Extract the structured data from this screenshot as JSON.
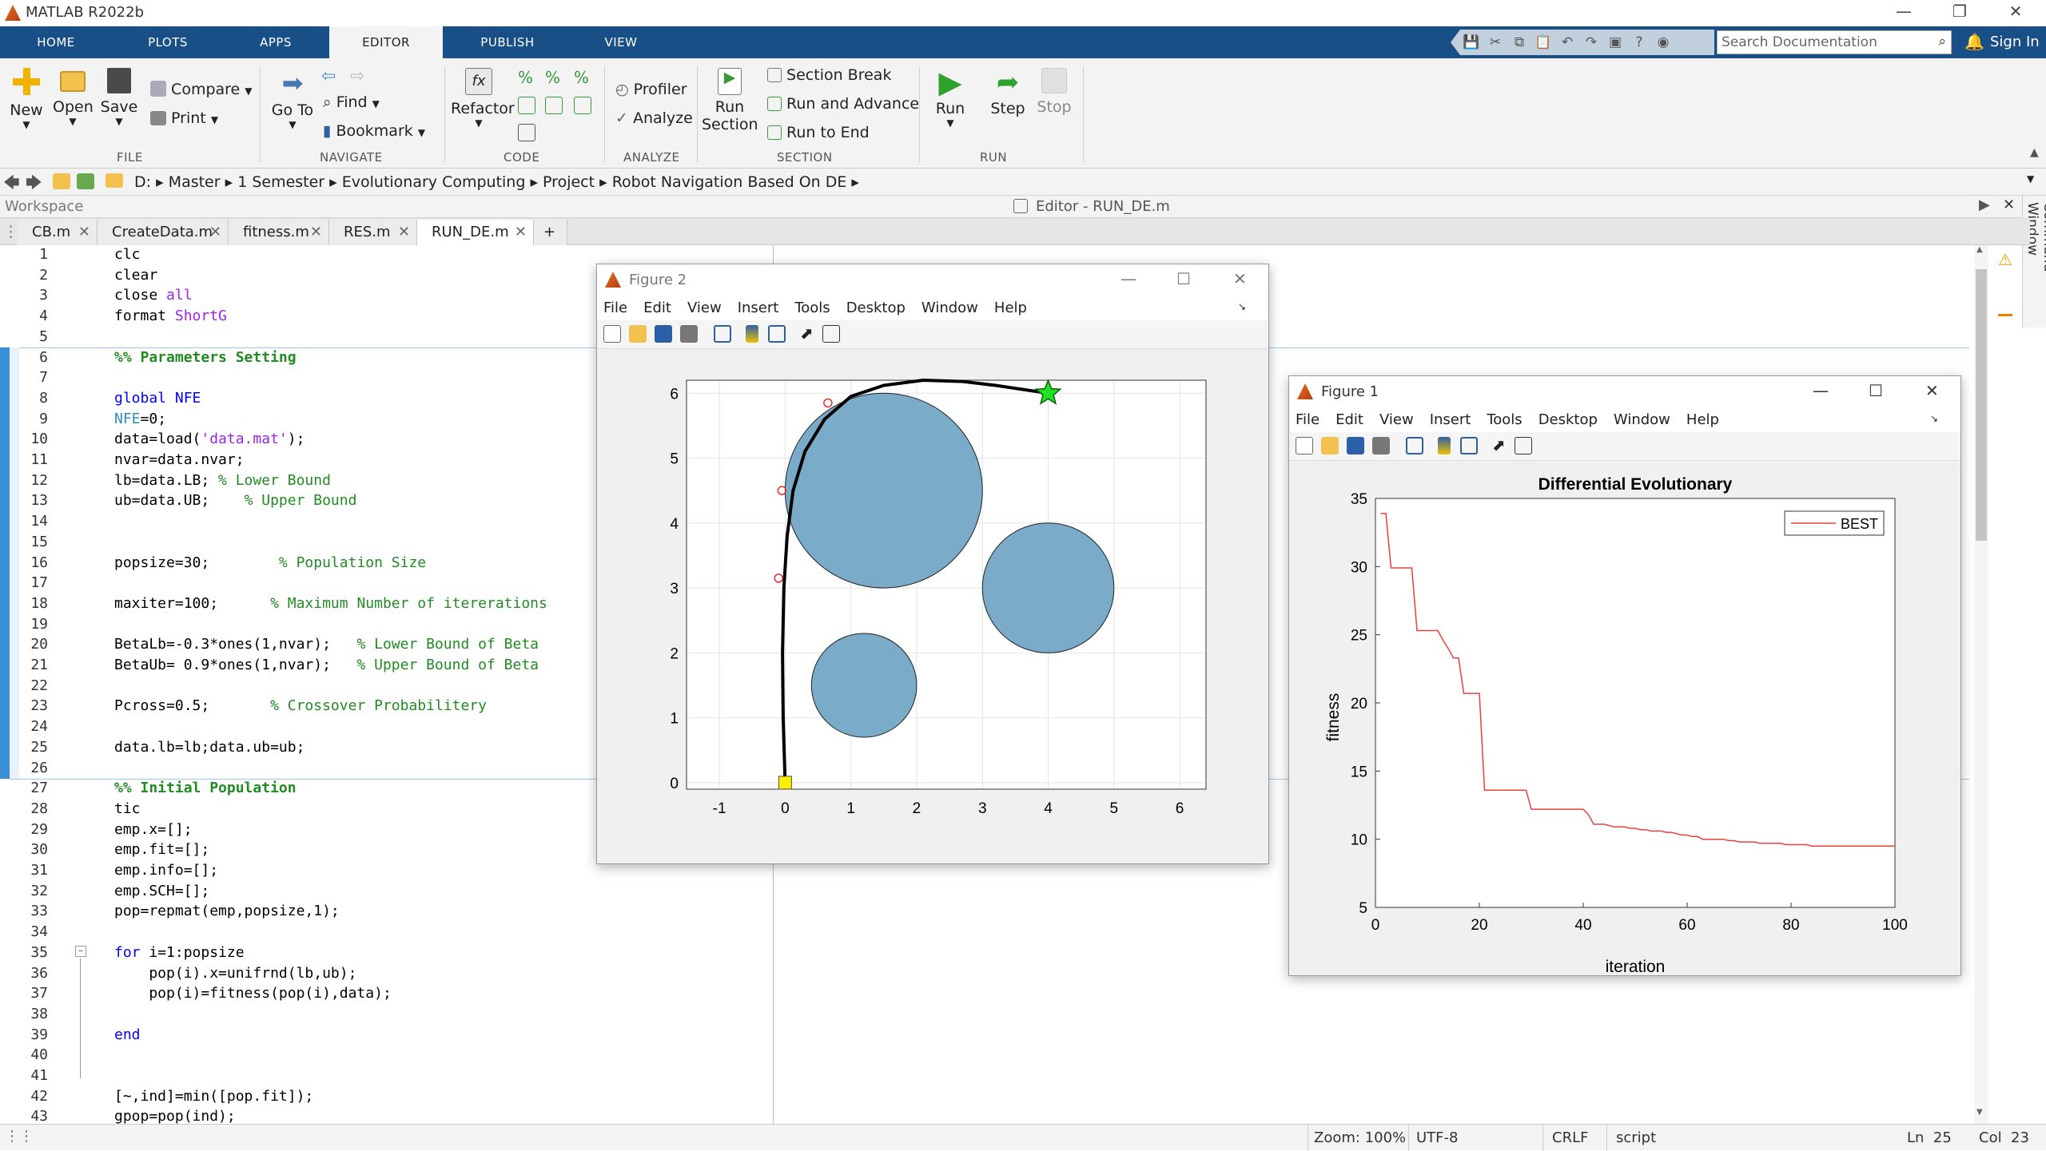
{
  "app": {
    "title": "MATLAB R2022b"
  },
  "toolstrip": {
    "tabs": [
      "HOME",
      "PLOTS",
      "APPS",
      "EDITOR",
      "PUBLISH",
      "VIEW"
    ],
    "search_placeholder": "Search Documentation",
    "signin": "Sign In"
  },
  "ribbon": {
    "file": {
      "new": "New",
      "open": "Open",
      "save": "Save",
      "compare": "Compare",
      "print": "Print",
      "group": "FILE"
    },
    "navigate": {
      "goto": "Go To",
      "find": "Find",
      "bookmark": "Bookmark",
      "group": "NAVIGATE"
    },
    "code": {
      "refactor": "Refactor",
      "group": "CODE"
    },
    "analyze": {
      "profiler": "Profiler",
      "analyze": "Analyze",
      "group": "ANALYZE"
    },
    "section": {
      "run_section": "Run Section",
      "section_break": "Section Break",
      "run_advance": "Run and Advance",
      "run_end": "Run to End",
      "group": "SECTION"
    },
    "run": {
      "run": "Run",
      "step": "Step",
      "stop": "Stop",
      "group": "RUN"
    }
  },
  "address": [
    "D:",
    "Master",
    "1 Semester",
    "Evolutionary Computing",
    "Project",
    "Robot Navigation Based On DE"
  ],
  "workspace_label": "Workspace",
  "editor_title": "Editor - RUN_DE.m",
  "command_window_label": "Command Window",
  "editor_tabs": [
    "CB.m",
    "CreateData.m",
    "fitness.m",
    "RES.m",
    "RUN_DE.m"
  ],
  "code_lines": [
    {
      "n": "1",
      "t": "clc"
    },
    {
      "n": "2",
      "t": "clear"
    },
    {
      "n": "3",
      "t": "close all"
    },
    {
      "n": "4",
      "t": "format ShortG"
    },
    {
      "n": "5",
      "t": ""
    },
    {
      "n": "6",
      "t": "%% Parameters Setting"
    },
    {
      "n": "7",
      "t": ""
    },
    {
      "n": "8",
      "t": "global NFE"
    },
    {
      "n": "9",
      "t": "NFE=0;"
    },
    {
      "n": "10",
      "t": "data=load('data.mat');"
    },
    {
      "n": "11",
      "t": "nvar=data.nvar;"
    },
    {
      "n": "12",
      "t": "lb=data.LB; % Lower Bound"
    },
    {
      "n": "13",
      "t": "ub=data.UB;    % Upper Bound"
    },
    {
      "n": "14",
      "t": ""
    },
    {
      "n": "15",
      "t": ""
    },
    {
      "n": "16",
      "t": "popsize=30;        % Population Size"
    },
    {
      "n": "17",
      "t": ""
    },
    {
      "n": "18",
      "t": "maxiter=100;      % Maximum Number of itererations"
    },
    {
      "n": "19",
      "t": ""
    },
    {
      "n": "20",
      "t": "BetaLb=-0.3*ones(1,nvar);   % Lower Bound of Beta"
    },
    {
      "n": "21",
      "t": "BetaUb= 0.9*ones(1,nvar);   % Upper Bound of Beta"
    },
    {
      "n": "22",
      "t": ""
    },
    {
      "n": "23",
      "t": "Pcross=0.5;       % Crossover Probabilitery"
    },
    {
      "n": "24",
      "t": ""
    },
    {
      "n": "25",
      "t": "data.lb=lb;data.ub=ub;"
    },
    {
      "n": "26",
      "t": ""
    },
    {
      "n": "27",
      "t": "%% Initial Population"
    },
    {
      "n": "28",
      "t": "tic"
    },
    {
      "n": "29",
      "t": "emp.x=[];"
    },
    {
      "n": "30",
      "t": "emp.fit=[];"
    },
    {
      "n": "31",
      "t": "emp.info=[];"
    },
    {
      "n": "32",
      "t": "emp.SCH=[];"
    },
    {
      "n": "33",
      "t": "pop=repmat(emp,popsize,1);"
    },
    {
      "n": "34",
      "t": ""
    },
    {
      "n": "35",
      "t": "for i=1:popsize"
    },
    {
      "n": "36",
      "t": "    pop(i).x=unifrnd(lb,ub);"
    },
    {
      "n": "37",
      "t": "    pop(i)=fitness(pop(i),data);"
    },
    {
      "n": "38",
      "t": ""
    },
    {
      "n": "39",
      "t": "end"
    },
    {
      "n": "40",
      "t": ""
    },
    {
      "n": "41",
      "t": ""
    },
    {
      "n": "42",
      "t": "[~,ind]=min([pop.fit]);"
    },
    {
      "n": "43",
      "t": "gpop=pop(ind);"
    }
  ],
  "status": {
    "zoom": "Zoom: 100%",
    "encoding": "UTF-8",
    "eol": "CRLF",
    "type": "script",
    "ln": "Ln  25",
    "col": "Col  23"
  },
  "figure_menu": [
    "File",
    "Edit",
    "View",
    "Insert",
    "Tools",
    "Desktop",
    "Window",
    "Help"
  ],
  "figure2": {
    "title": "Figure 2",
    "xticks": [
      "-1",
      "0",
      "1",
      "2",
      "3",
      "4",
      "5",
      "6"
    ],
    "yticks": [
      "0",
      "1",
      "2",
      "3",
      "4",
      "5",
      "6"
    ]
  },
  "figure1": {
    "title": "Figure 1",
    "plot_title": "Differential Evolutionary",
    "xlabel": "iteration",
    "ylabel": "fitness",
    "legend": "BEST",
    "xticks": [
      "0",
      "20",
      "40",
      "60",
      "80",
      "100"
    ],
    "yticks": [
      "5",
      "10",
      "15",
      "20",
      "25",
      "30",
      "35"
    ]
  },
  "chart_data": [
    {
      "type": "scatter",
      "title": "",
      "xlim": [
        -1.5,
        6.4
      ],
      "ylim": [
        -0.1,
        6.2
      ],
      "grid": true,
      "obstacles": [
        {
          "cx": 1.5,
          "cy": 4.5,
          "r": 1.5
        },
        {
          "cx": 4.0,
          "cy": 3.0,
          "r": 1.0
        },
        {
          "cx": 1.2,
          "cy": 1.5,
          "r": 0.8
        }
      ],
      "start": [
        0,
        0
      ],
      "goal": [
        4,
        6
      ],
      "path_x": [
        0,
        -0.03,
        -0.04,
        -0.02,
        0.03,
        0.12,
        0.3,
        0.6,
        1.0,
        1.5,
        2.1,
        2.7,
        3.2,
        3.6,
        4.0
      ],
      "path_y": [
        0,
        1.0,
        2.0,
        3.0,
        3.8,
        4.5,
        5.1,
        5.6,
        5.95,
        6.12,
        6.2,
        6.18,
        6.12,
        6.06,
        6.0
      ],
      "waypoints_x": [
        -0.1,
        -0.05,
        0.65
      ],
      "waypoints_y": [
        3.15,
        4.5,
        5.85
      ]
    },
    {
      "type": "line",
      "title": "Differential Evolutionary",
      "xlabel": "iteration",
      "ylabel": "fitness",
      "xlim": [
        0,
        100
      ],
      "ylim": [
        5,
        35
      ],
      "series": [
        {
          "name": "BEST",
          "x": [
            1,
            2,
            3,
            4,
            5,
            6,
            7,
            8,
            9,
            10,
            11,
            12,
            13,
            14,
            15,
            16,
            17,
            18,
            19,
            20,
            21,
            22,
            23,
            24,
            25,
            26,
            27,
            28,
            29,
            30,
            31,
            32,
            33,
            34,
            35,
            36,
            37,
            38,
            39,
            40,
            41,
            42,
            43,
            44,
            45,
            46,
            47,
            48,
            49,
            50,
            51,
            52,
            53,
            54,
            55,
            56,
            57,
            58,
            59,
            60,
            61,
            62,
            63,
            64,
            65,
            66,
            67,
            68,
            69,
            70,
            71,
            72,
            73,
            74,
            75,
            76,
            77,
            78,
            79,
            80,
            81,
            82,
            83,
            84,
            85,
            86,
            87,
            88,
            89,
            90,
            91,
            92,
            93,
            94,
            95,
            96,
            97,
            98,
            99,
            100
          ],
          "y": [
            33.9,
            33.9,
            29.9,
            29.9,
            29.9,
            29.9,
            29.9,
            25.3,
            25.3,
            25.3,
            25.3,
            25.3,
            24.6,
            24.0,
            23.3,
            23.3,
            20.7,
            20.7,
            20.7,
            20.7,
            13.6,
            13.6,
            13.6,
            13.6,
            13.6,
            13.6,
            13.6,
            13.6,
            13.6,
            12.2,
            12.2,
            12.2,
            12.2,
            12.2,
            12.2,
            12.2,
            12.2,
            12.2,
            12.2,
            12.2,
            11.8,
            11.1,
            11.1,
            11.1,
            11.0,
            10.9,
            10.9,
            10.9,
            10.8,
            10.8,
            10.7,
            10.7,
            10.6,
            10.6,
            10.6,
            10.5,
            10.5,
            10.4,
            10.3,
            10.3,
            10.2,
            10.2,
            10.0,
            10.0,
            10.0,
            10.0,
            10.0,
            9.9,
            9.9,
            9.8,
            9.8,
            9.8,
            9.8,
            9.7,
            9.7,
            9.7,
            9.7,
            9.7,
            9.6,
            9.6,
            9.6,
            9.6,
            9.6,
            9.5,
            9.5,
            9.5,
            9.5,
            9.5,
            9.5,
            9.5,
            9.5,
            9.5,
            9.5,
            9.5,
            9.5,
            9.5,
            9.5,
            9.5,
            9.5,
            9.5
          ]
        }
      ]
    }
  ]
}
